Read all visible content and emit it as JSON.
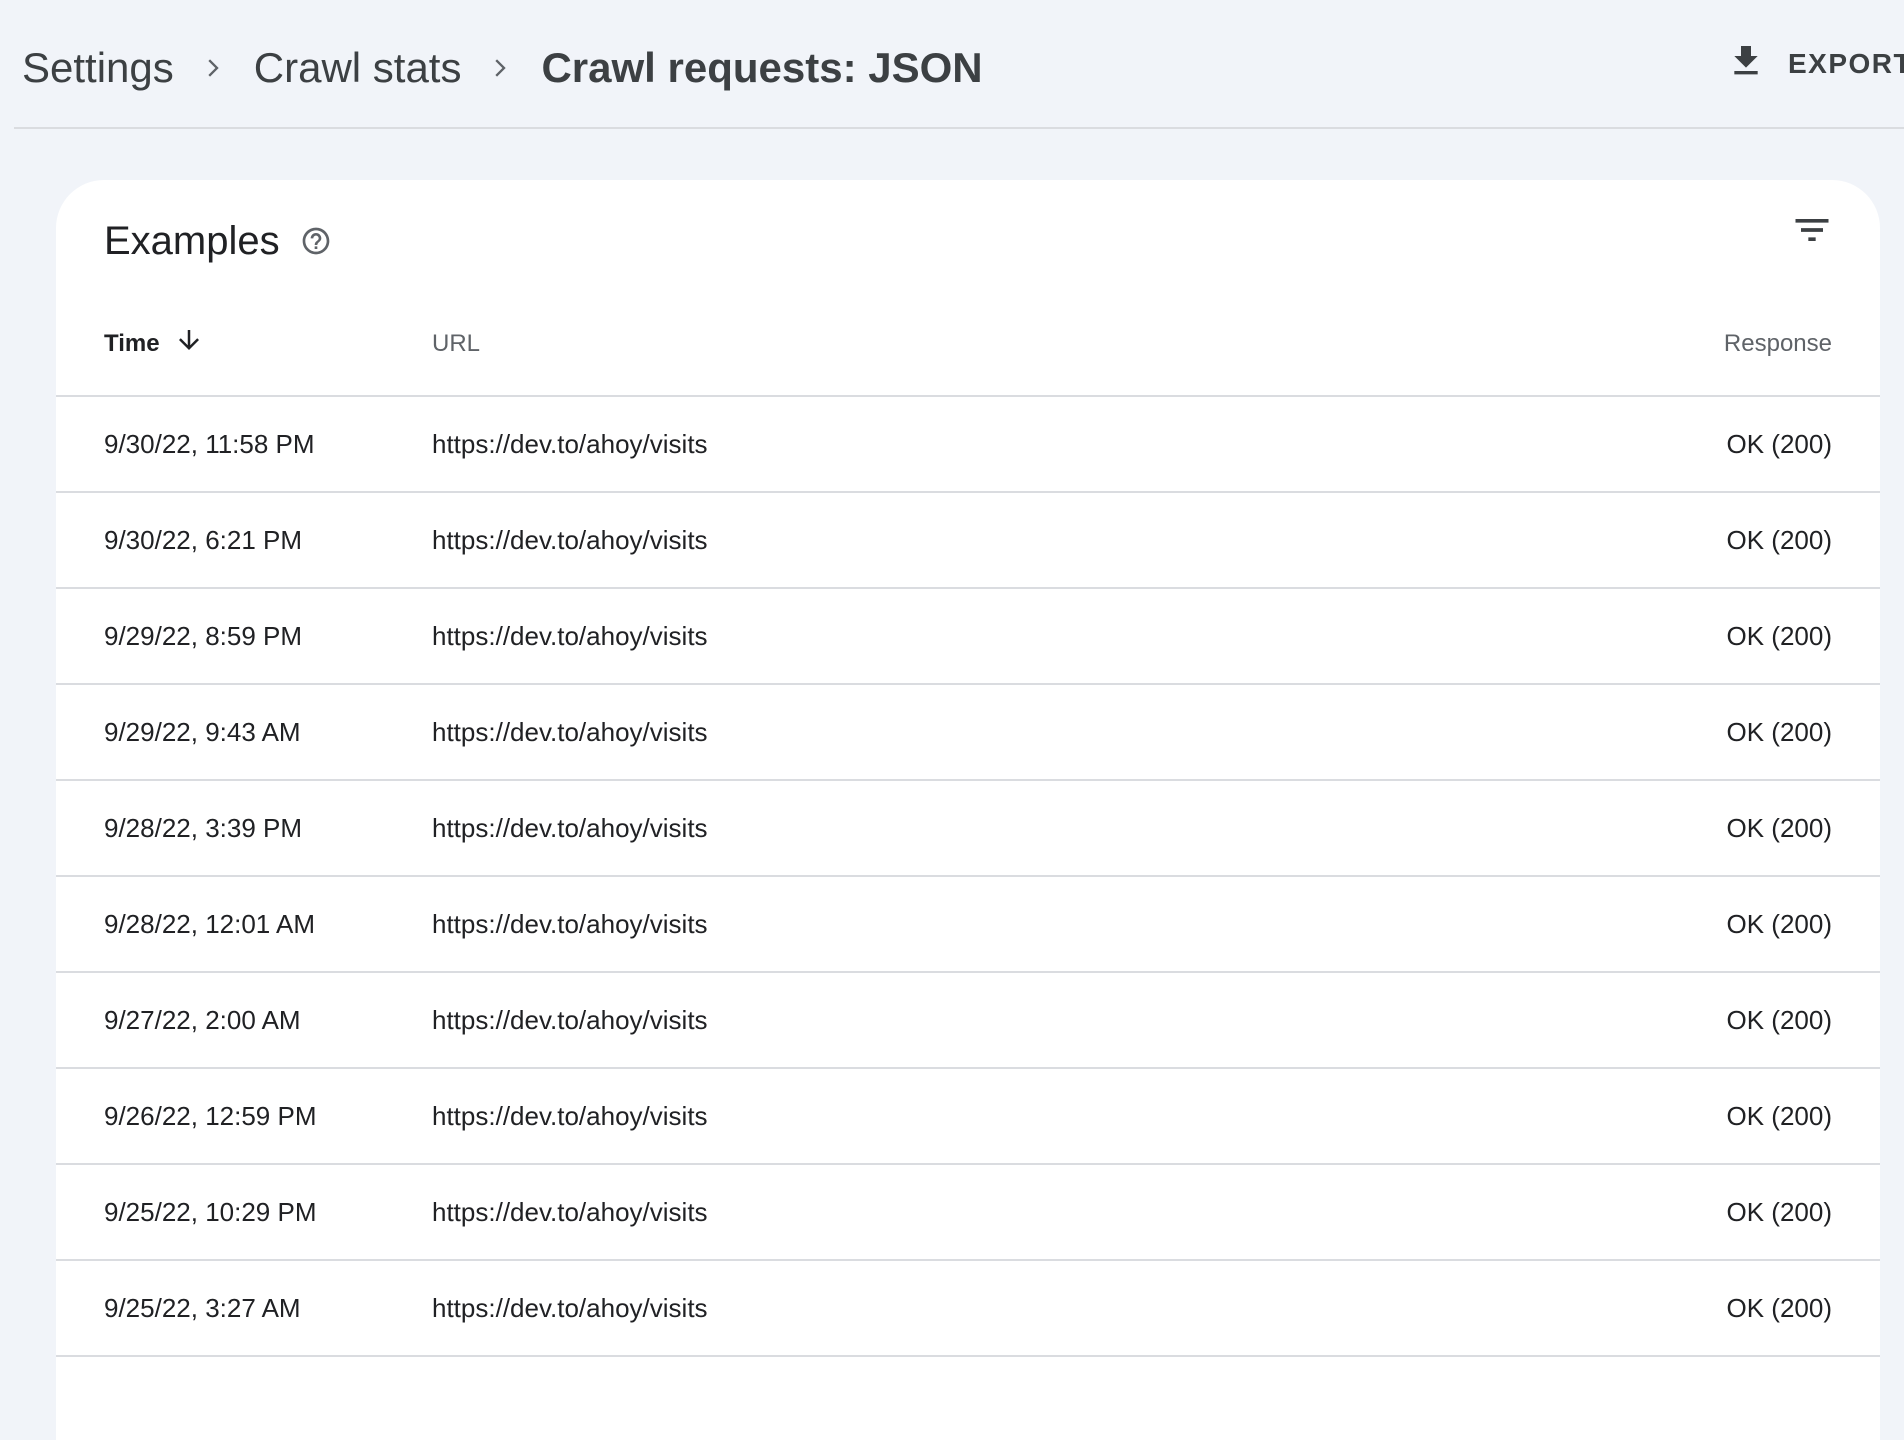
{
  "breadcrumb": {
    "items": [
      "Settings",
      "Crawl stats"
    ],
    "current": "Crawl requests: JSON"
  },
  "export": {
    "label": "EXPORT",
    "icon": "download-icon"
  },
  "card": {
    "title": "Examples",
    "help_icon": "help-circle-icon",
    "filter_icon": "filter-icon"
  },
  "table": {
    "columns": {
      "time": "Time",
      "url": "URL",
      "response": "Response"
    },
    "sort": {
      "column": "Time",
      "direction": "descending",
      "icon": "arrow-down-icon"
    },
    "rows": [
      {
        "time": "9/30/22, 11:58 PM",
        "url": "https://dev.to/ahoy/visits",
        "response": "OK (200)"
      },
      {
        "time": "9/30/22, 6:21 PM",
        "url": "https://dev.to/ahoy/visits",
        "response": "OK (200)"
      },
      {
        "time": "9/29/22, 8:59 PM",
        "url": "https://dev.to/ahoy/visits",
        "response": "OK (200)"
      },
      {
        "time": "9/29/22, 9:43 AM",
        "url": "https://dev.to/ahoy/visits",
        "response": "OK (200)"
      },
      {
        "time": "9/28/22, 3:39 PM",
        "url": "https://dev.to/ahoy/visits",
        "response": "OK (200)"
      },
      {
        "time": "9/28/22, 12:01 AM",
        "url": "https://dev.to/ahoy/visits",
        "response": "OK (200)"
      },
      {
        "time": "9/27/22, 2:00 AM",
        "url": "https://dev.to/ahoy/visits",
        "response": "OK (200)"
      },
      {
        "time": "9/26/22, 12:59 PM",
        "url": "https://dev.to/ahoy/visits",
        "response": "OK (200)"
      },
      {
        "time": "9/25/22, 10:29 PM",
        "url": "https://dev.to/ahoy/visits",
        "response": "OK (200)"
      },
      {
        "time": "9/25/22, 3:27 AM",
        "url": "https://dev.to/ahoy/visits",
        "response": "OK (200)"
      }
    ]
  }
}
